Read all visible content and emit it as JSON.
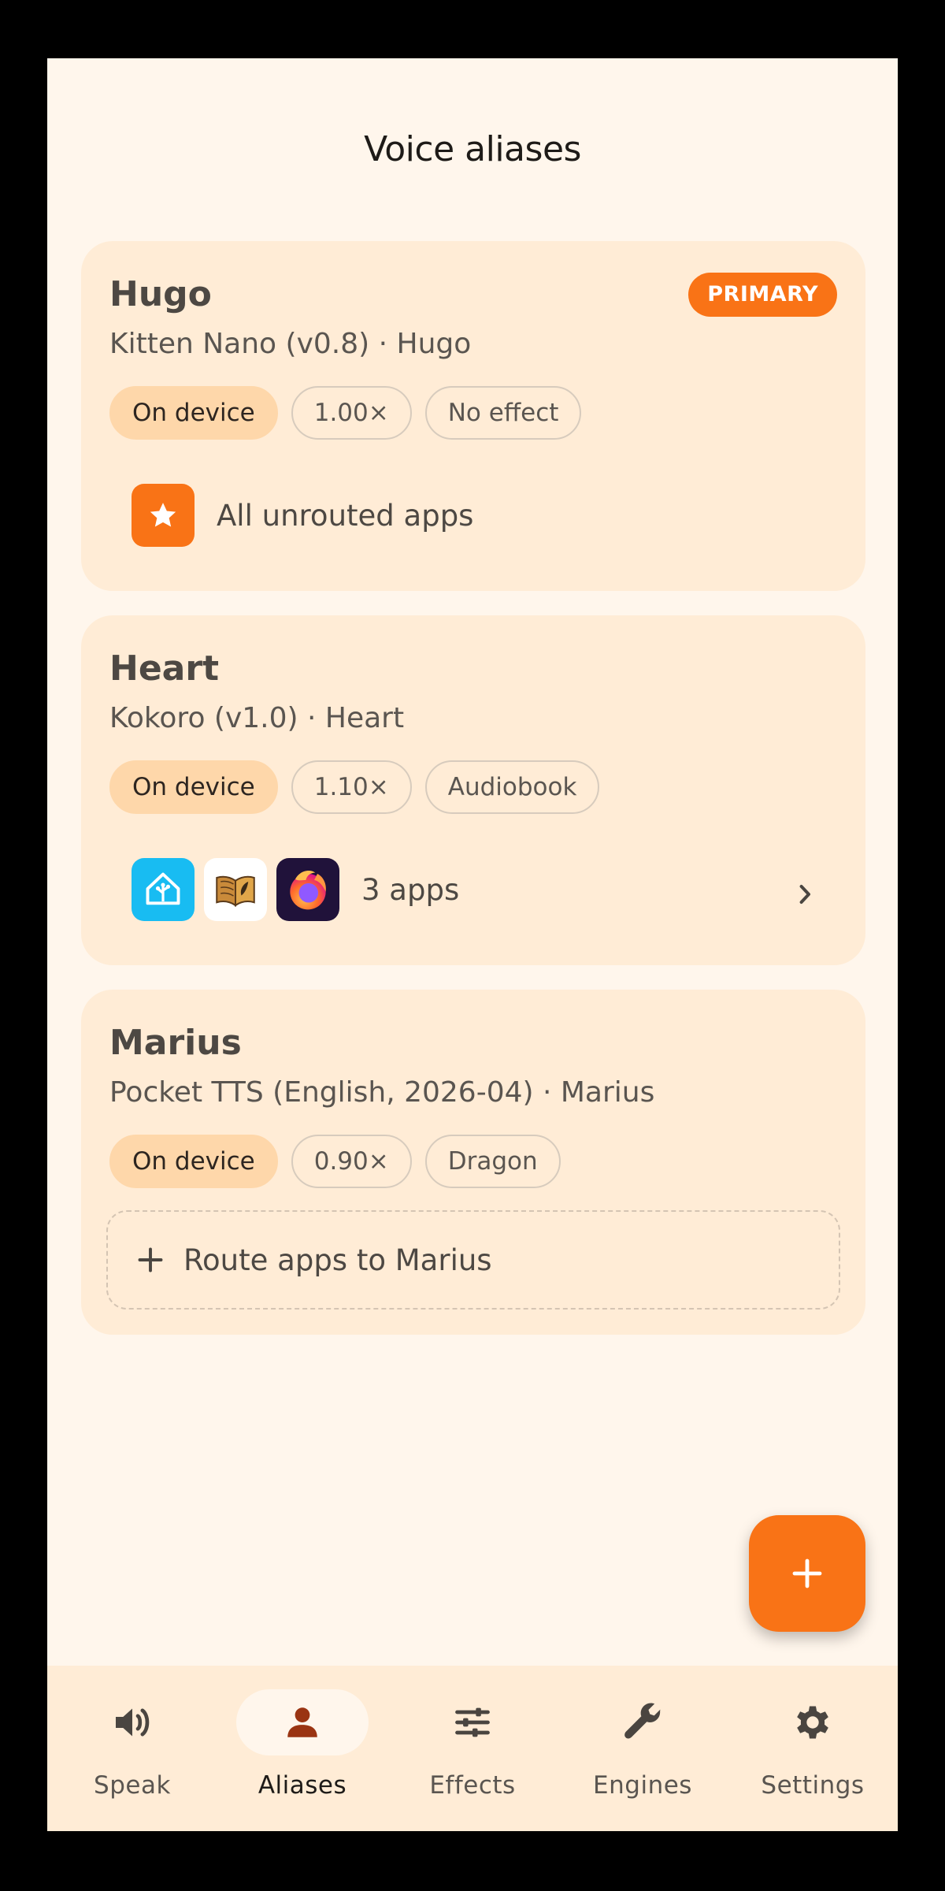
{
  "page": {
    "title": "Voice aliases"
  },
  "colors": {
    "accent": "#f97316",
    "card": "#ffecd6",
    "background": "#fff6ec"
  },
  "aliases": [
    {
      "name": "Hugo",
      "subtitle": "Kitten Nano (v0.8) · Hugo",
      "badge": "PRIMARY",
      "chips": [
        "On device",
        "1.00×",
        "No effect"
      ],
      "route": {
        "label": "All unrouted apps",
        "icon": "star-icon"
      }
    },
    {
      "name": "Heart",
      "subtitle": "Kokoro (v1.0) · Heart",
      "chips": [
        "On device",
        "1.10×",
        "Audiobook"
      ],
      "route": {
        "label": "3 apps",
        "icons": [
          "home-assistant-icon",
          "book-reader-icon",
          "firefox-icon"
        ]
      }
    },
    {
      "name": "Marius",
      "subtitle": "Pocket TTS (English, 2026-04) · Marius",
      "chips": [
        "On device",
        "0.90×",
        "Dragon"
      ],
      "add_route_label": "Route apps to Marius"
    }
  ],
  "fab": {
    "icon": "plus-icon"
  },
  "nav": [
    {
      "label": "Speak",
      "icon": "speaker-icon"
    },
    {
      "label": "Aliases",
      "icon": "person-icon",
      "active": true
    },
    {
      "label": "Effects",
      "icon": "sliders-icon"
    },
    {
      "label": "Engines",
      "icon": "wrench-icon"
    },
    {
      "label": "Settings",
      "icon": "gear-icon"
    }
  ]
}
